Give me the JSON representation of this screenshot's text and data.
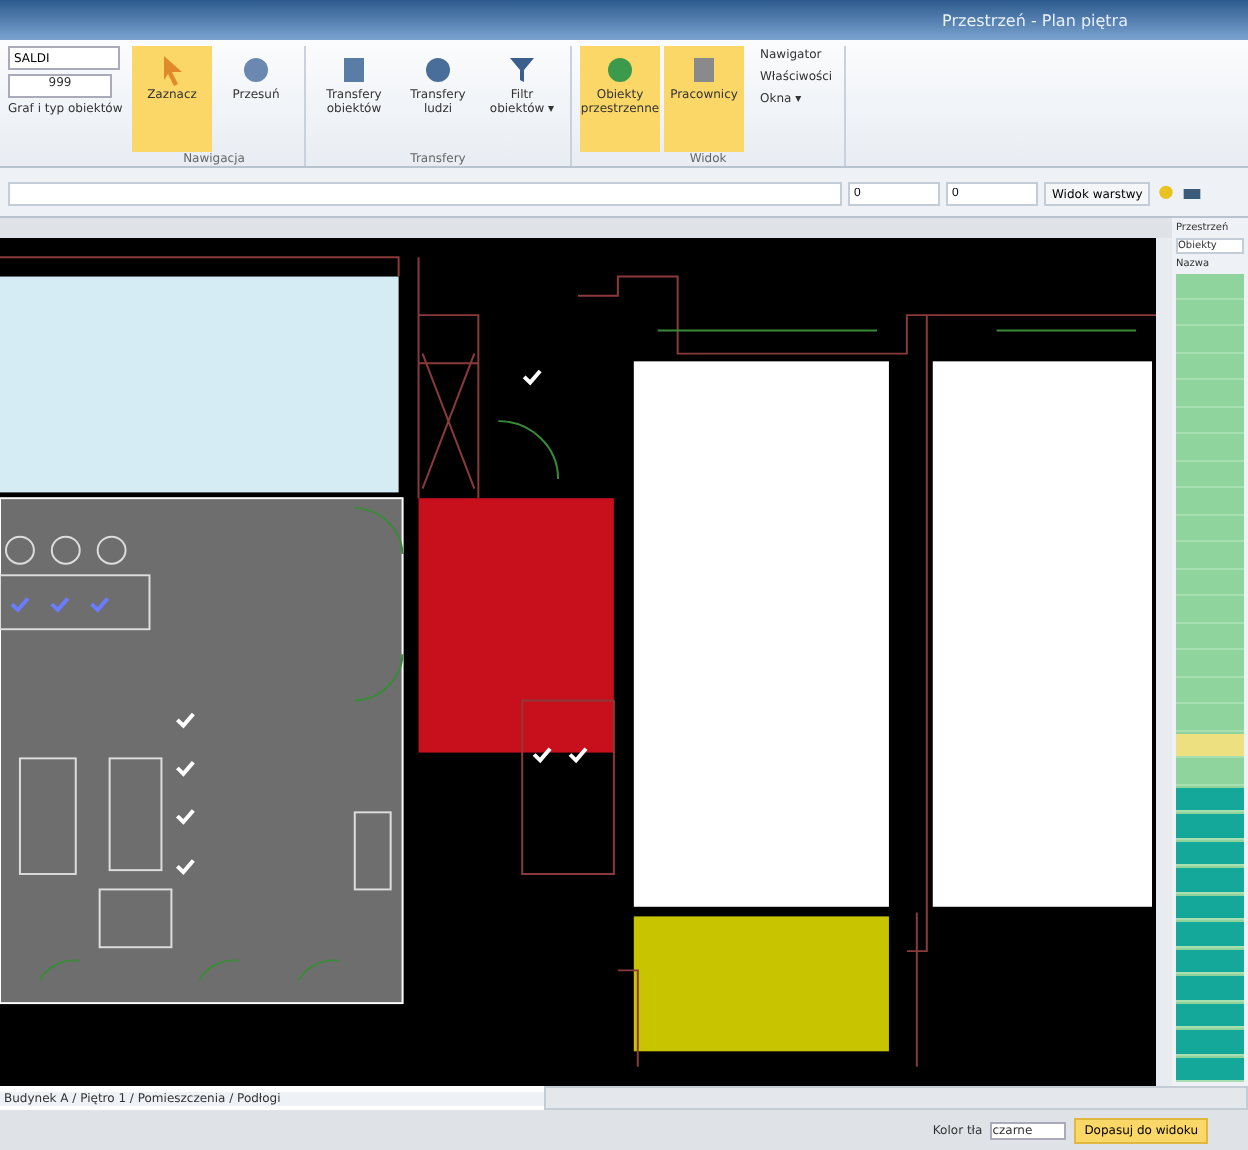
{
  "window": {
    "title": "Przestrzeń - Plan piętra"
  },
  "ribbon": {
    "left": {
      "field": "SALDI",
      "select": "999",
      "label": "Graf i typ obiektów"
    },
    "groups": [
      {
        "label": "Nawigacja",
        "buttons": [
          {
            "label": "Zaznacz",
            "kind": "pointer",
            "selected": true
          },
          {
            "label": "Przesuń",
            "kind": "hand",
            "selected": false
          }
        ]
      },
      {
        "label": "Transfery",
        "buttons": [
          {
            "label": "Transfery obiektów",
            "kind": "boxes",
            "selected": false
          },
          {
            "label": "Transfery ludzi",
            "kind": "people",
            "selected": false
          },
          {
            "label": "Filtr obiektów ▾",
            "kind": "funnel",
            "selected": false
          }
        ]
      },
      {
        "label": "Widok",
        "buttons": [
          {
            "label": "Obiekty przestrzenne",
            "kind": "map",
            "selected": true
          },
          {
            "label": "Pracownicy",
            "kind": "doc",
            "selected": true
          }
        ],
        "small": [
          "Nawigator",
          "Właściwości",
          "Okna ▾"
        ]
      }
    ]
  },
  "toolbar": {
    "field_1": "0",
    "field_2": "0",
    "button": "Widok warstwy"
  },
  "side_panel": {
    "title": "Przestrzeń",
    "filter": "Obiekty",
    "header": "Nazwa"
  },
  "path_bar": "Budynek A / Piętro 1 / Pomieszczenia / Podłogi",
  "status_bar": {
    "label": "Kolor tła",
    "select": "czarne",
    "button": "Dopasuj do widoku"
  }
}
